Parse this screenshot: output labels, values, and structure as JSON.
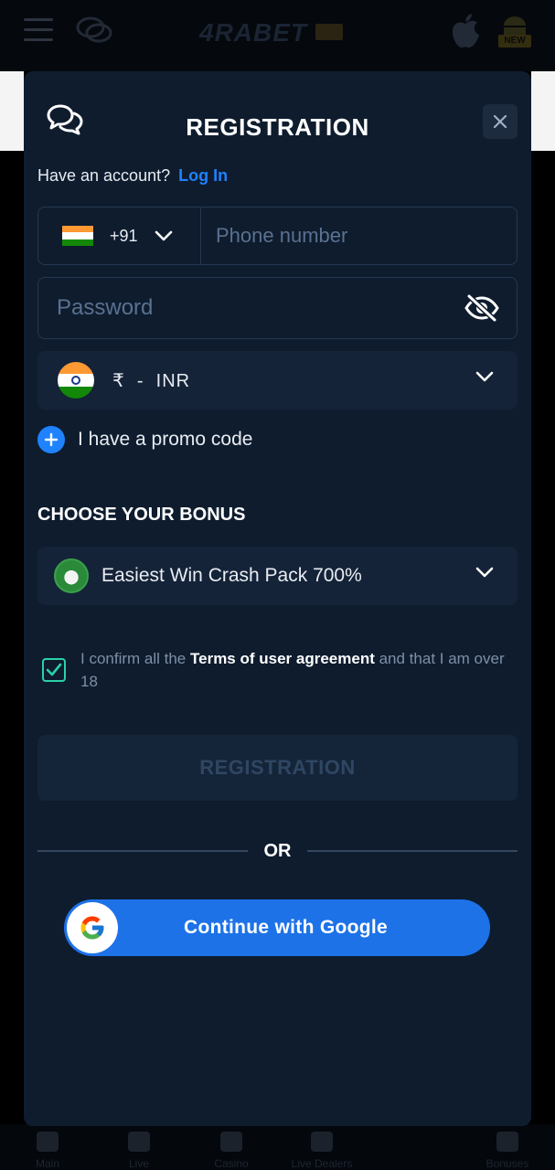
{
  "background": {
    "logo_text": "4RABET",
    "android_badge": "NEW",
    "tabs": [
      "Main",
      "Live",
      "Casino",
      "Live Dealers",
      "Bonuses"
    ]
  },
  "modal": {
    "title": "REGISTRATION",
    "account_prompt": "Have an account?",
    "login_link": "Log In",
    "phone": {
      "country_code": "+91",
      "placeholder": "Phone number"
    },
    "password": {
      "placeholder": "Password"
    },
    "currency": {
      "symbol": "₹",
      "separator": "-",
      "code": "INR"
    },
    "promo_label": "I have a promo code",
    "bonus_title": "CHOOSE YOUR BONUS",
    "bonus_selected": "Easiest Win Crash Pack 700%",
    "terms": {
      "prefix": "I confirm all the ",
      "link": "Terms of user agreement",
      "suffix": " and that I am over 18",
      "checked": true
    },
    "register_button": "REGISTRATION",
    "or_label": "OR",
    "google_button": "Continue with Google"
  },
  "colors": {
    "modal_bg": "#0e1c2e",
    "accent_blue": "#1f82ff",
    "google_blue": "#1d72e8",
    "check_green": "#2bd1a8"
  }
}
